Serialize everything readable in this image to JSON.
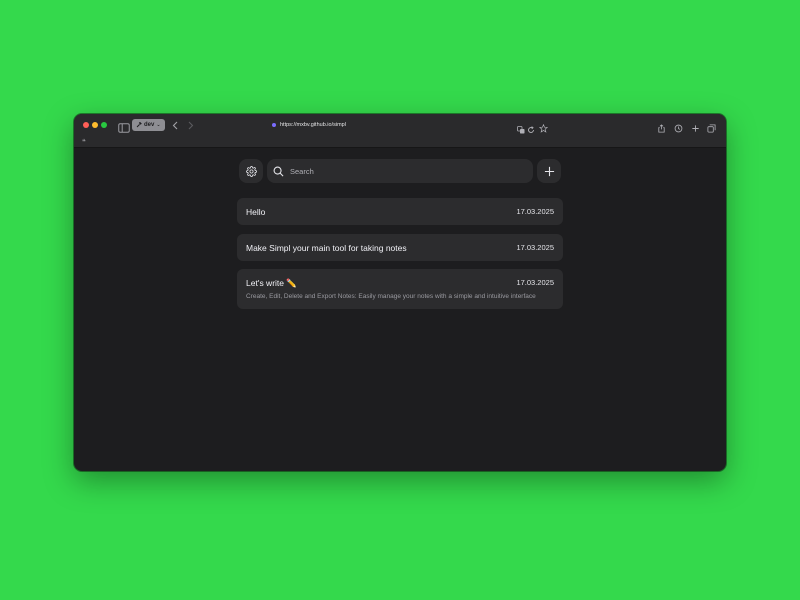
{
  "browser": {
    "profile_label": "dev",
    "profile_chevron": "⌄",
    "url": "https://mxbv.github.io/simpl",
    "bookmark_glyph": "❝",
    "accent_dot_color": "#7a6cff"
  },
  "app": {
    "search": {
      "placeholder": "Search",
      "value": ""
    },
    "notes": [
      {
        "title": "Hello",
        "date": "17.03.2025",
        "preview": ""
      },
      {
        "title": "Make Simpl your main tool for taking notes",
        "date": "17.03.2025",
        "preview": ""
      },
      {
        "title": "Let's write ✏️",
        "date": "17.03.2025",
        "preview": "Create, Edit, Delete and Export Notes: Easily manage your notes with a simple and intuitive interface"
      }
    ]
  },
  "colors": {
    "desktop_background": "#34d94c",
    "window_background": "#1d1d1f",
    "card_background": "#2c2c2e"
  },
  "icons": {
    "sidebar": "sidebar-icon",
    "back": "chevron-left-icon",
    "forward": "chevron-right-icon",
    "translate": "translate-icon",
    "reload": "reload-icon",
    "bookmark": "star-icon",
    "share": "share-icon",
    "history": "history-icon",
    "new_tab": "plus-icon",
    "tabs": "tabs-overview-icon",
    "settings": "gear-icon",
    "search": "search-icon",
    "add": "plus-icon"
  }
}
